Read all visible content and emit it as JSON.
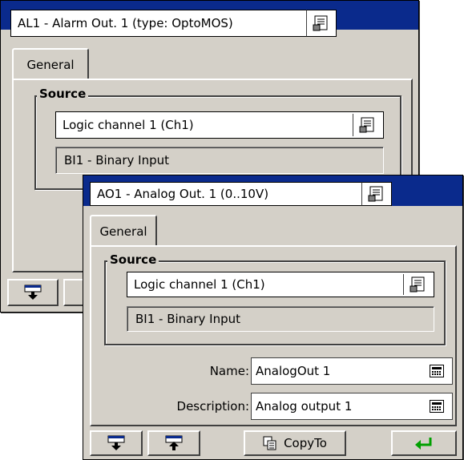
{
  "back_window": {
    "title_combo": "AL1 - Alarm Out. 1 (type: OptoMOS)",
    "tab_general": "General",
    "source_group_label": "Source",
    "source_combo": "Logic channel 1 (Ch1)",
    "source_readonly": "BI1 - Binary Input"
  },
  "front_window": {
    "title_combo": "AO1 - Analog Out. 1 (0..10V)",
    "tab_general": "General",
    "source_group_label": "Source",
    "source_combo": "Logic channel 1 (Ch1)",
    "source_readonly": "BI1 - Binary Input",
    "name_label": "Name:",
    "name_value": "AnalogOut 1",
    "description_label": "Description:",
    "description_value": "Analog output 1",
    "toolbar": {
      "copyto_label": "CopyTo"
    }
  },
  "icons": [
    "properties-icon",
    "calculator-icon",
    "move-down-icon",
    "move-up-icon",
    "copy-icon",
    "enter-arrow-icon"
  ],
  "colors": {
    "titlebar": "#0a2a8c",
    "enter_arrow": "#00a000",
    "window_bg": "#d4d0c8"
  }
}
